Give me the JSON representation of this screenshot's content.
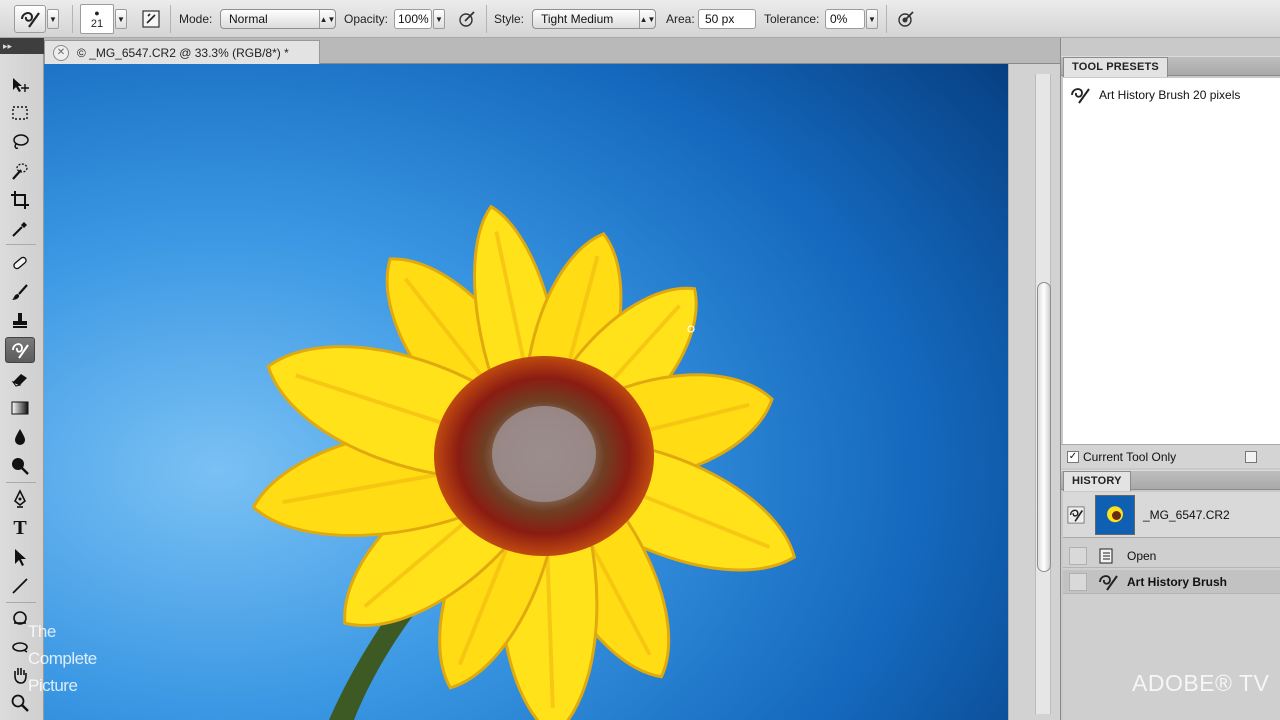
{
  "options_bar": {
    "brush_size": "21",
    "mode_label": "Mode:",
    "mode_value": "Normal",
    "opacity_label": "Opacity:",
    "opacity_value": "100%",
    "style_label": "Style:",
    "style_value": "Tight Medium",
    "area_label": "Area:",
    "area_value": "50 px",
    "tolerance_label": "Tolerance:",
    "tolerance_value": "0%"
  },
  "document": {
    "tab_title": "© _MG_6547.CR2 @ 33.3% (RGB/8*) *"
  },
  "tool_presets": {
    "title": "TOOL PRESETS",
    "items": [
      {
        "label": "Art History Brush 20 pixels",
        "icon": "art-history-brush-icon"
      }
    ],
    "current_tool_only_label": "Current Tool Only",
    "current_tool_only_checked": true
  },
  "history": {
    "title": "HISTORY",
    "snapshot_label": "_MG_6547.CR2",
    "items": [
      {
        "label": "Open",
        "icon": "document-icon"
      },
      {
        "label": "Art History Brush",
        "icon": "art-history-brush-icon",
        "selected": true
      }
    ]
  },
  "watermarks": {
    "left_line1": "The",
    "left_line2": "Complete",
    "left_line3": "Picture",
    "right": "ADOBE® TV"
  },
  "colors": {
    "sky_deep": "#0b4f9a",
    "sky_light": "#5fb2ef",
    "petal_yellow": "#ffe21a",
    "petal_orange": "#f3b40d",
    "center_red": "#8a1a10",
    "center_gray": "#8b7b78"
  }
}
